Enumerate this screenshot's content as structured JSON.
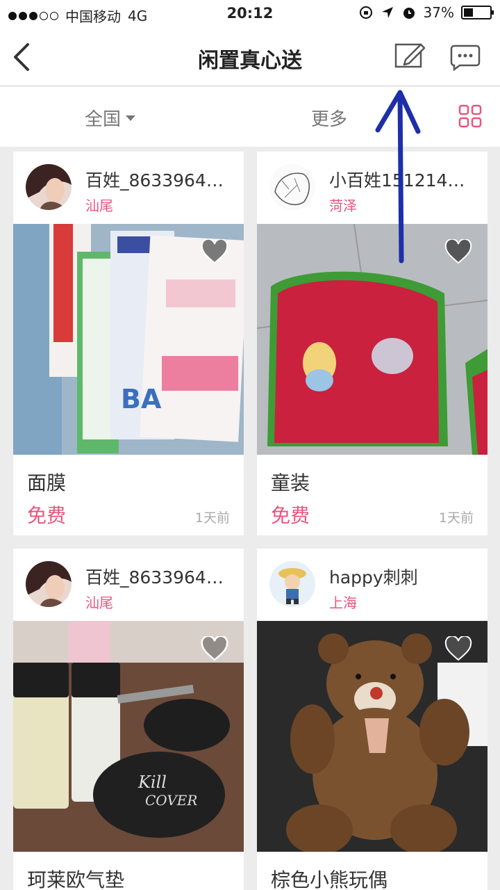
{
  "status_bar": {
    "carrier": "中国移动",
    "network": "4G",
    "time": "20:12",
    "battery": "37%",
    "battery_level": 0.37,
    "signal_bars_filled": 3
  },
  "navbar": {
    "title": "闲置真心送",
    "back_icon": "chevron-left-icon",
    "edit_icon": "edit-icon",
    "chat_icon": "chat-bubble-icon"
  },
  "filter": {
    "region": "全国",
    "more": "更多",
    "grid_icon": "grid-view-icon"
  },
  "colors": {
    "accent": "#e8547c",
    "annotation_arrow": "#1d2fa8"
  },
  "items": [
    {
      "user": "百姓_8633964…",
      "city": "汕尾",
      "title": "面膜",
      "price": "免费",
      "ago": "1天前"
    },
    {
      "user": "小百姓151214…",
      "city": "菏泽",
      "title": "童装",
      "price": "免费",
      "ago": "1天前"
    },
    {
      "user": "百姓_8633964…",
      "city": "汕尾",
      "title": "珂莱欧气垫",
      "price": "",
      "ago": ""
    },
    {
      "user": "happy刺刺",
      "city": "上海",
      "title": "棕色小熊玩偶",
      "price": "",
      "ago": ""
    }
  ]
}
